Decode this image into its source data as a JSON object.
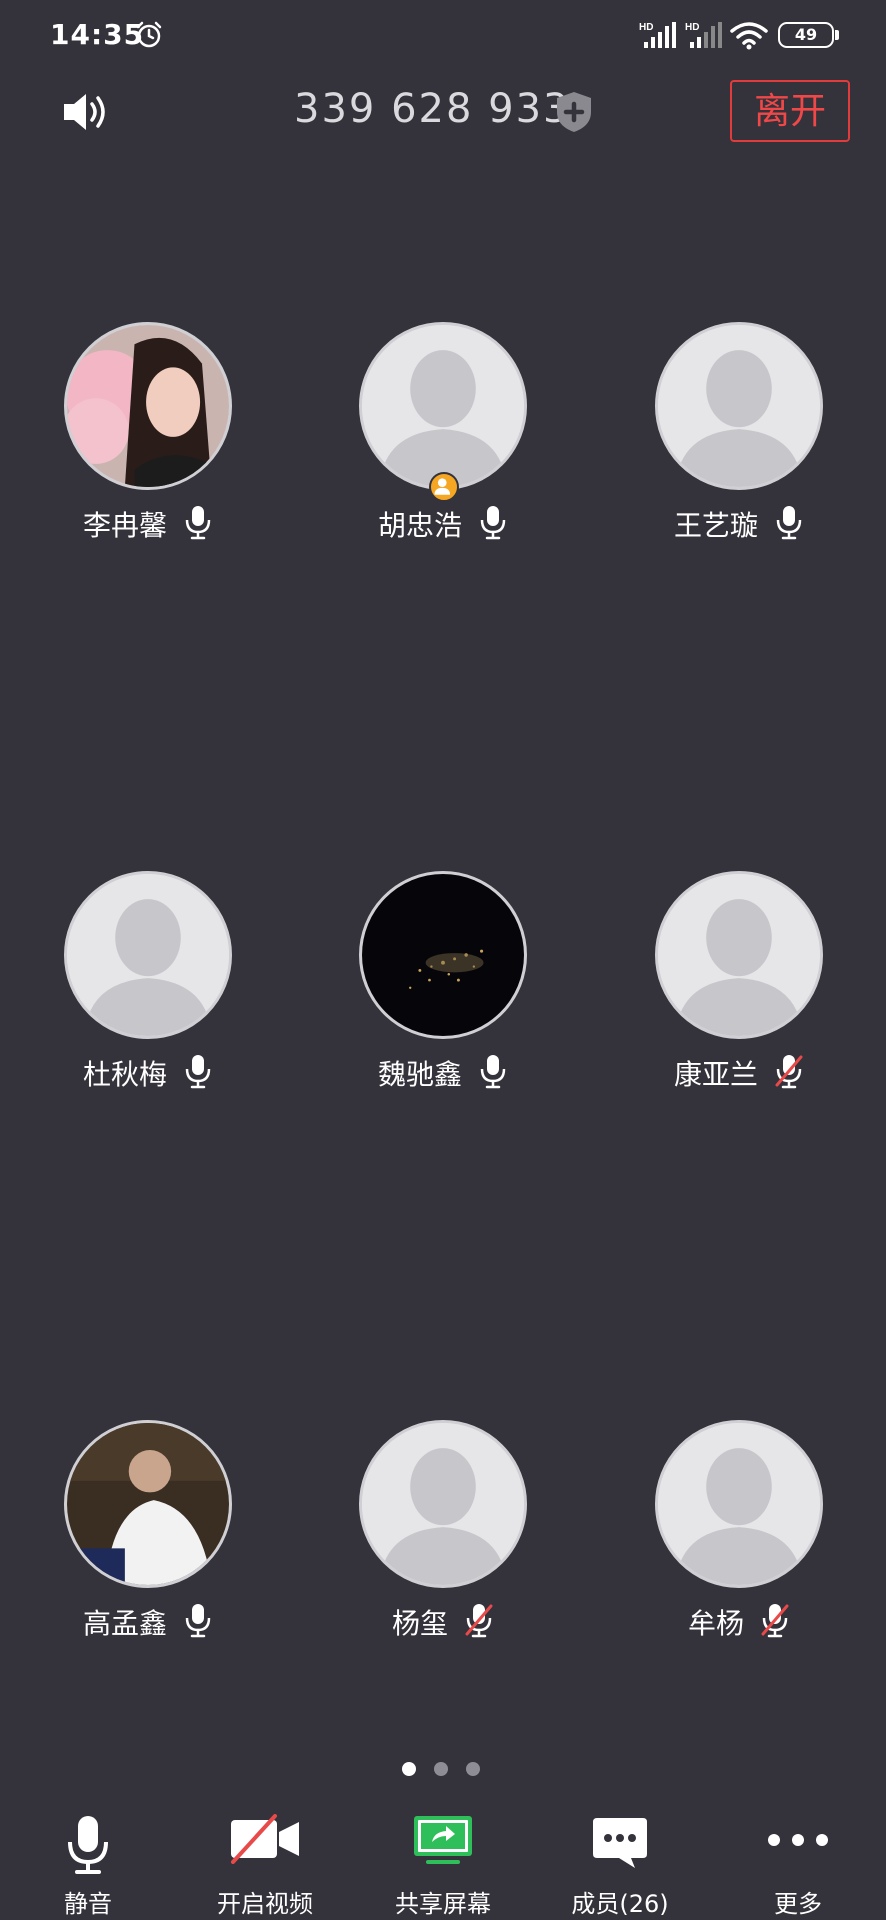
{
  "status_bar": {
    "time": "14:35",
    "signal1_label": "HD",
    "signal2_label": "HD",
    "battery": "49"
  },
  "header": {
    "meeting_id": "339 628 933",
    "leave_label": "离开"
  },
  "participants": [
    {
      "name": "李冉馨",
      "avatar": "photo-girl",
      "mic": "on"
    },
    {
      "name": "胡忠浩",
      "avatar": "default",
      "mic": "on",
      "host": true
    },
    {
      "name": "王艺璇",
      "avatar": "default",
      "mic": "on"
    },
    {
      "name": "杜秋梅",
      "avatar": "default",
      "mic": "on"
    },
    {
      "name": "魏驰鑫",
      "avatar": "photo-night-city",
      "mic": "on"
    },
    {
      "name": "康亚兰",
      "avatar": "default",
      "mic": "muted"
    },
    {
      "name": "高孟鑫",
      "avatar": "photo-man",
      "mic": "on"
    },
    {
      "name": "杨玺",
      "avatar": "default",
      "mic": "muted"
    },
    {
      "name": "牟杨",
      "avatar": "default",
      "mic": "muted"
    }
  ],
  "pager": {
    "pages": 3,
    "active": 0
  },
  "toolbar": {
    "mute_label": "静音",
    "video_label": "开启视频",
    "share_label": "共享屏幕",
    "members_label": "成员(26)",
    "more_label": "更多"
  },
  "colors": {
    "background": "#34323a",
    "leave_red": "#e23b3b",
    "share_green": "#2fbf5a",
    "muted_red": "#e84a4a",
    "host_badge": "#f5a623"
  }
}
